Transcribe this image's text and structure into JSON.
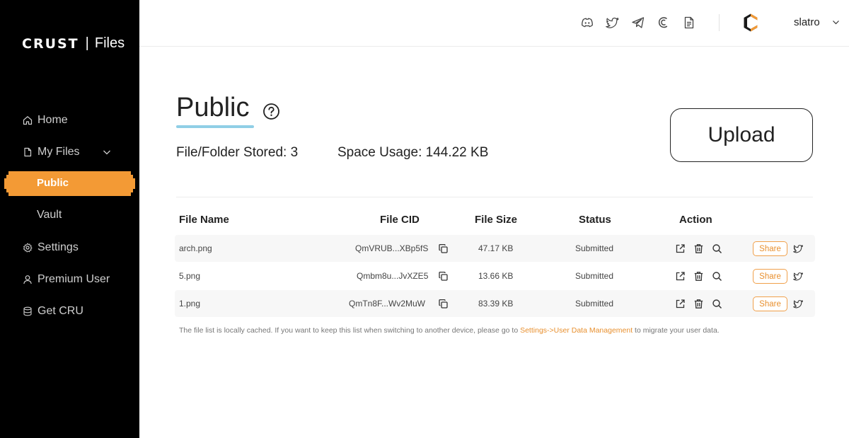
{
  "brand": {
    "name": "CRUST",
    "separator": "|",
    "product": "Files"
  },
  "sidebar": {
    "items": [
      {
        "label": "Home",
        "icon": "home-icon"
      },
      {
        "label": "My Files",
        "icon": "file-icon"
      },
      {
        "label": "Public"
      },
      {
        "label": "Vault"
      },
      {
        "label": "Settings",
        "icon": "gear-icon"
      },
      {
        "label": "Premium User",
        "icon": "user-icon"
      },
      {
        "label": "Get CRU",
        "icon": "database-icon"
      }
    ],
    "active": "Public",
    "colors": {
      "background": "#000000",
      "active": "#f39a35"
    }
  },
  "header": {
    "icons": [
      "discord-icon",
      "twitter-icon",
      "telegram-icon",
      "crust-c-icon",
      "docs-icon"
    ],
    "username": "slatro"
  },
  "main": {
    "title": "Public",
    "stats": {
      "stored": "File/Folder Stored: 3",
      "usage": "Space Usage: 144.22 KB"
    },
    "upload_label": "Upload",
    "table": {
      "headers": [
        "File Name",
        "File CID",
        "File Size",
        "Status",
        "Action"
      ],
      "rows": [
        {
          "name": "arch.png",
          "cid": "QmVRUB...XBp5fS",
          "size": "47.17 KB",
          "status": "Submitted",
          "share": "Share"
        },
        {
          "name": "5.png",
          "cid": "Qmbm8u...JvXZE5",
          "size": "13.66 KB",
          "status": "Submitted",
          "share": "Share"
        },
        {
          "name": "1.png",
          "cid": "QmTn8F...Wv2MuW",
          "size": "83.39 KB",
          "status": "Submitted",
          "share": "Share"
        }
      ]
    },
    "note": {
      "before": "The file list is locally cached. If you want to keep this list when switching to another device, please go to ",
      "link": "Settings->User Data Management",
      "after": " to migrate your user data."
    },
    "colors": {
      "accent": "#e8902f",
      "title_underline": "#90cfe6"
    }
  }
}
